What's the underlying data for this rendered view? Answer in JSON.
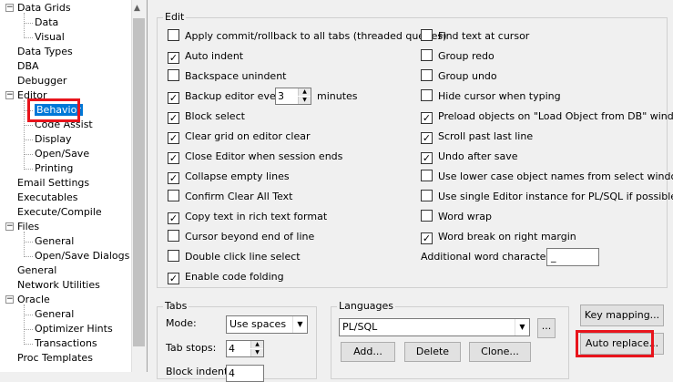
{
  "tree": {
    "items": [
      {
        "label": "Data Grids",
        "level": 0,
        "toggle": "−"
      },
      {
        "label": "Data",
        "level": 1
      },
      {
        "label": "Visual",
        "level": 1
      },
      {
        "label": "Data Types",
        "level": 0
      },
      {
        "label": "DBA",
        "level": 0
      },
      {
        "label": "Debugger",
        "level": 0
      },
      {
        "label": "Editor",
        "level": 0,
        "toggle": "−"
      },
      {
        "label": "Behavior",
        "level": 1,
        "selected": true
      },
      {
        "label": "Code Assist",
        "level": 1
      },
      {
        "label": "Display",
        "level": 1
      },
      {
        "label": "Open/Save",
        "level": 1
      },
      {
        "label": "Printing",
        "level": 1
      },
      {
        "label": "Email Settings",
        "level": 0
      },
      {
        "label": "Executables",
        "level": 0
      },
      {
        "label": "Execute/Compile",
        "level": 0
      },
      {
        "label": "Files",
        "level": 0,
        "toggle": "−"
      },
      {
        "label": "General",
        "level": 1
      },
      {
        "label": "Open/Save Dialogs",
        "level": 1
      },
      {
        "label": "General",
        "level": 0
      },
      {
        "label": "Network Utilities",
        "level": 0
      },
      {
        "label": "Oracle",
        "level": 0,
        "toggle": "−"
      },
      {
        "label": "General",
        "level": 1
      },
      {
        "label": "Optimizer Hints",
        "level": 1
      },
      {
        "label": "Transactions",
        "level": 1
      },
      {
        "label": "Proc Templates",
        "level": 0
      }
    ]
  },
  "edit": {
    "title": "Edit",
    "left": [
      {
        "label": "Apply commit/rollback to all tabs (threaded queries)",
        "checked": false
      },
      {
        "label": "Auto indent",
        "checked": true
      },
      {
        "label": "Backspace unindent",
        "checked": false
      },
      {
        "label": "Backup editor every",
        "checked": true
      },
      {
        "label": "Block select",
        "checked": true
      },
      {
        "label": "Clear grid on editor clear",
        "checked": true
      },
      {
        "label": "Close Editor when session ends",
        "checked": true
      },
      {
        "label": "Collapse empty lines",
        "checked": true
      },
      {
        "label": "Confirm Clear All Text",
        "checked": false
      },
      {
        "label": "Copy text in rich text format",
        "checked": true
      },
      {
        "label": "Cursor beyond end of line",
        "checked": false
      },
      {
        "label": "Double click line select",
        "checked": false
      },
      {
        "label": "Enable code folding",
        "checked": true
      }
    ],
    "right": [
      {
        "label": "Find text at cursor",
        "checked": false
      },
      {
        "label": "Group redo",
        "checked": false
      },
      {
        "label": "Group undo",
        "checked": false
      },
      {
        "label": "Hide cursor when typing",
        "checked": false
      },
      {
        "label": "Preload objects on \"Load Object from DB\" window",
        "checked": true
      },
      {
        "label": "Scroll past last line",
        "checked": true
      },
      {
        "label": "Undo after save",
        "checked": true
      },
      {
        "label": "Use lower case object names from select windows",
        "checked": false
      },
      {
        "label": "Use single Editor instance for PL/SQL if possible",
        "checked": false
      },
      {
        "label": "Word wrap",
        "checked": false
      },
      {
        "label": "Word break on right margin",
        "checked": true
      }
    ],
    "backup_value": "3",
    "backup_unit": "minutes",
    "additional_label": "Additional word characters:",
    "additional_value": "_"
  },
  "tabs": {
    "title": "Tabs",
    "mode_label": "Mode:",
    "mode_value": "Use spaces",
    "tabstops_label": "Tab stops:",
    "tabstops_value": "4",
    "blockindent_label": "Block indent:",
    "blockindent_value": "4"
  },
  "languages": {
    "title": "Languages",
    "value": "PL/SQL",
    "ellipsis": "...",
    "add": "Add...",
    "delete": "Delete",
    "clone": "Clone..."
  },
  "buttons": {
    "key_mapping": "Key mapping...",
    "auto_replace": "Auto replace..."
  }
}
